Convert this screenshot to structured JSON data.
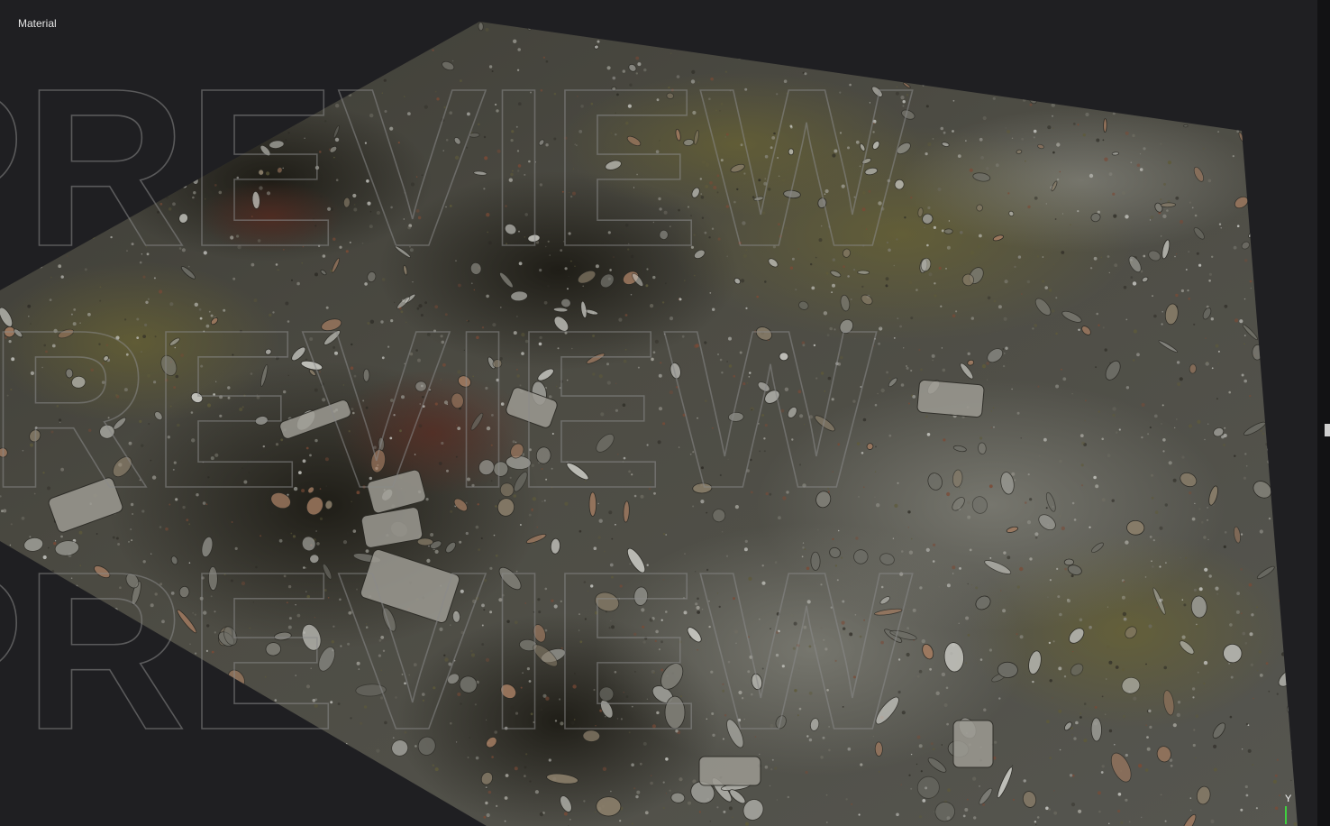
{
  "viewport": {
    "label": "Material",
    "background_color": "#1f1f22"
  },
  "watermark": {
    "text": "PREVIEW",
    "color": "#8a8a8a"
  },
  "axis_gizmo": {
    "label": "Y",
    "axis_color": "#3fd13f"
  },
  "surface": {
    "description_colors": {
      "base": "#4a4a44",
      "moss": "#5d5a33",
      "dark": "#26241f",
      "rust": "#7a3a2a",
      "stone": "#9b9b95"
    }
  }
}
